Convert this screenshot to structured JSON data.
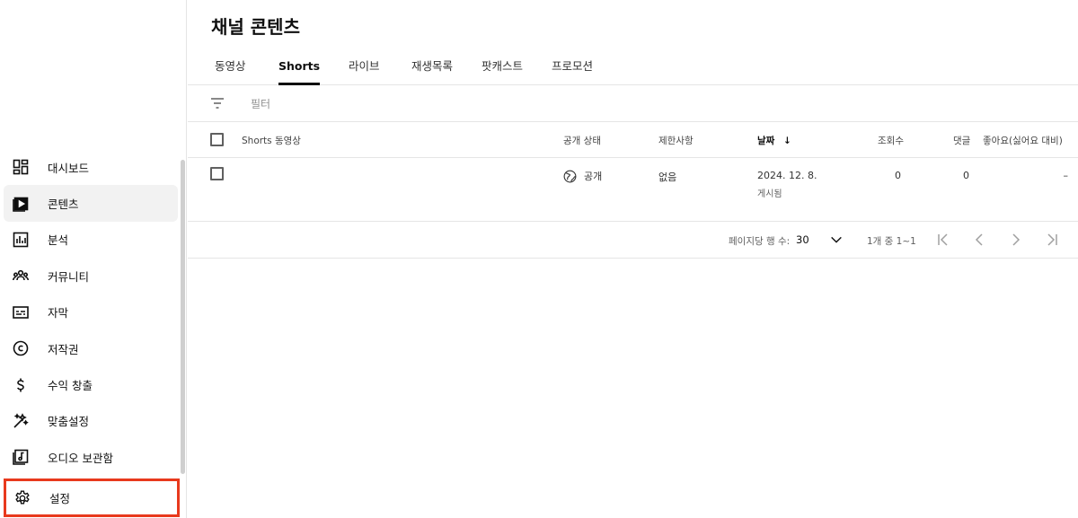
{
  "sidebar": {
    "items": [
      {
        "label": "대시보드",
        "icon": "dashboard-icon"
      },
      {
        "label": "콘텐츠",
        "icon": "content-icon",
        "active": true
      },
      {
        "label": "분석",
        "icon": "analytics-icon"
      },
      {
        "label": "커뮤니티",
        "icon": "community-icon"
      },
      {
        "label": "자막",
        "icon": "subtitles-icon"
      },
      {
        "label": "저작권",
        "icon": "copyright-icon"
      },
      {
        "label": "수익 창출",
        "icon": "dollar-icon"
      },
      {
        "label": "맞춤설정",
        "icon": "magic-wand-icon"
      },
      {
        "label": "오디오 보관함",
        "icon": "audio-library-icon"
      }
    ],
    "settings_label": "설정"
  },
  "header": {
    "title": "채널 콘텐츠"
  },
  "tabs": [
    "동영상",
    "Shorts",
    "라이브",
    "재생목록",
    "팟캐스트",
    "프로모션"
  ],
  "active_tab": "Shorts",
  "filter": {
    "placeholder": "필터"
  },
  "table": {
    "columns": {
      "video": "Shorts 동영상",
      "visibility": "공개 상태",
      "restrictions": "제한사항",
      "date": "날짜",
      "views": "조회수",
      "comments": "댓글",
      "likes": "좋아요(싫어요 대비)"
    },
    "rows": [
      {
        "visibility": "공개",
        "restrictions": "없음",
        "date": "2024. 12. 8.",
        "date_status": "게시됨",
        "views": "0",
        "comments": "0",
        "likes": "–"
      }
    ]
  },
  "pager": {
    "rows_per_page_label": "페이지당 행 수:",
    "rows_per_page": "30",
    "range": "1개 중 1~1"
  },
  "colors": {
    "highlight_border": "#e8391d",
    "active_bg": "#f2f2f2"
  }
}
